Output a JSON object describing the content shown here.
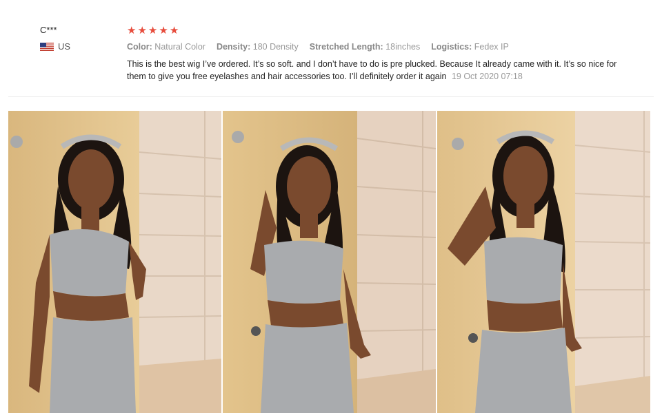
{
  "reviewer": {
    "name": "C***",
    "country": "US",
    "flag_icon": "us-flag-icon"
  },
  "rating": {
    "stars": 5,
    "max": 5,
    "color": "#e74c3c"
  },
  "attributes": [
    {
      "key": "Color:",
      "value": "Natural Color"
    },
    {
      "key": "Density:",
      "value": "180 Density"
    },
    {
      "key": "Stretched Length:",
      "value": "18inches"
    },
    {
      "key": "Logistics:",
      "value": "Fedex IP"
    }
  ],
  "review": {
    "text": "This is the best wig I’ve ordered. It’s so soft. and I don’t have to do is pre plucked. Because It already came with it. It’s so nice for them to give you free eyelashes and hair accessories too. I’ll definitely order it again",
    "date": "19 Oct 2020 07:18"
  },
  "photos": [
    {
      "name": "review-photo-1"
    },
    {
      "name": "review-photo-2"
    },
    {
      "name": "review-photo-3"
    }
  ]
}
